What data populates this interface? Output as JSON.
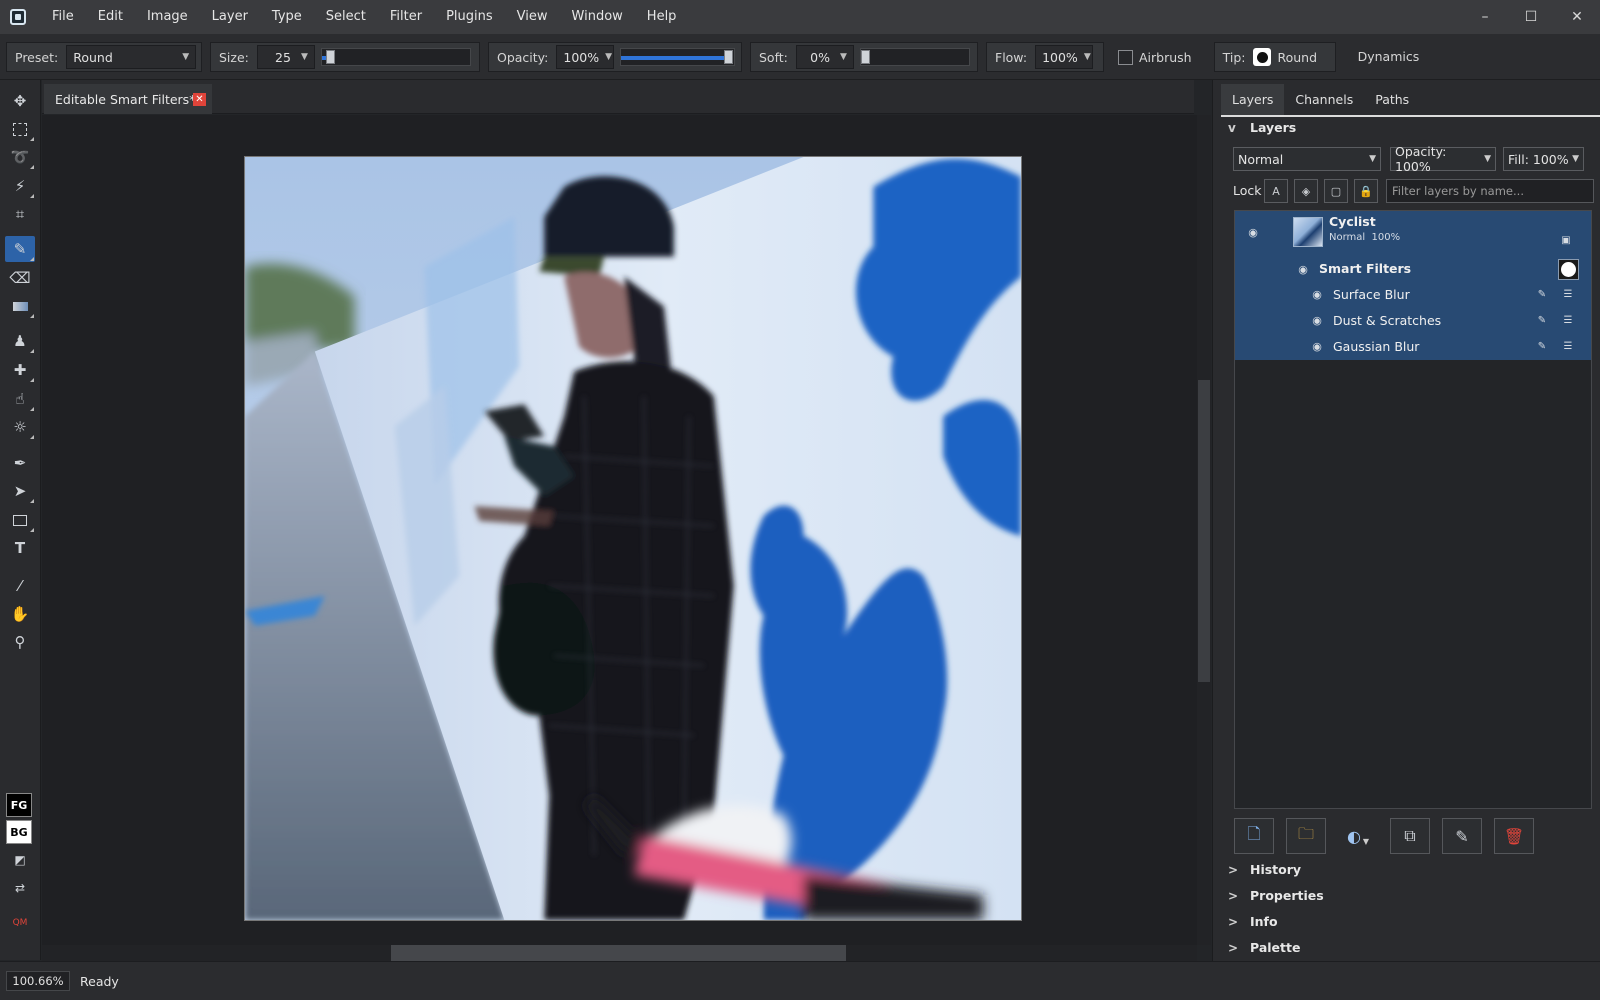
{
  "menu": [
    "File",
    "Edit",
    "Image",
    "Layer",
    "Type",
    "Select",
    "Filter",
    "Plugins",
    "View",
    "Window",
    "Help"
  ],
  "window_controls": {
    "minimize": "–",
    "maximize": "☐",
    "close": "✕"
  },
  "options": {
    "preset_label": "Preset:",
    "preset_value": "Round",
    "size_label": "Size:",
    "size_value": "25",
    "size_slider": 0.03,
    "opacity_label": "Opacity:",
    "opacity_value": "100%",
    "opacity_slider": 1.0,
    "soft_label": "Soft:",
    "soft_value": "0%",
    "soft_slider": 0.0,
    "flow_label": "Flow:",
    "flow_value": "100%",
    "airbrush_label": "Airbrush",
    "airbrush_checked": false,
    "tip_label": "Tip:",
    "tip_value": "Round",
    "dynamics_label": "Dynamics"
  },
  "document": {
    "tab_title": "Editable Smart Filters*",
    "close_glyph": "✕"
  },
  "toolbox": {
    "fg_label": "FG",
    "bg_label": "BG",
    "qm_label": "QM",
    "active_tool": "brush-tool"
  },
  "panel": {
    "tabs": [
      "Layers",
      "Channels",
      "Paths"
    ],
    "active_tab": "Layers",
    "layers_section_title": "Layers",
    "layers_section_chevron": "v",
    "blend_mode": "Normal",
    "opacity": "Opacity: 100%",
    "fill": "Fill: 100%",
    "lock_label": "Lock",
    "filter_placeholder": "Filter layers by name...",
    "layer": {
      "name": "Cyclist",
      "subtitle": "Normal  100%"
    },
    "smart_filters_label": "Smart Filters",
    "filters": [
      "Surface Blur",
      "Dust & Scratches",
      "Gaussian Blur"
    ],
    "collapsed_sections": [
      {
        "chevron": ">",
        "title": "History"
      },
      {
        "chevron": ">",
        "title": "Properties"
      },
      {
        "chevron": ">",
        "title": "Info"
      },
      {
        "chevron": ">",
        "title": "Palette"
      }
    ]
  },
  "status": {
    "zoom": "100.66%",
    "text": "Ready"
  },
  "colors": {
    "accent": "#2d63a8",
    "selection": "#284a73",
    "slider_fill": "#2f74d8",
    "close_red": "#e0443a"
  }
}
